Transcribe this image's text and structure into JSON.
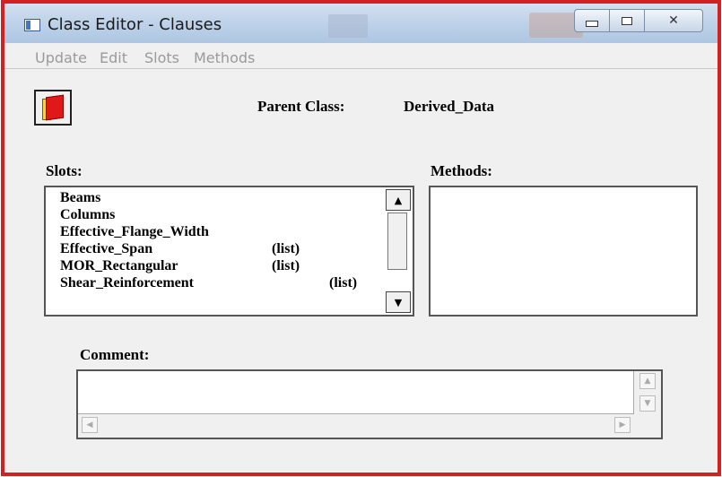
{
  "window": {
    "title": "Class Editor - Clauses",
    "accent_color": "#d42020",
    "controls": {
      "minimize_icon": "minimize-icon",
      "maximize_icon": "maximize-icon",
      "close_glyph": "✕"
    }
  },
  "menu": {
    "items": [
      {
        "label": "Update"
      },
      {
        "label": "Edit"
      },
      {
        "label": "Slots"
      },
      {
        "label": "Methods"
      }
    ]
  },
  "toolbar": {
    "icon": "book-icon"
  },
  "parent_class": {
    "label": "Parent Class:",
    "value": "Derived_Data"
  },
  "slots": {
    "label": "Slots:",
    "items": [
      {
        "name": "Beams",
        "type": ""
      },
      {
        "name": "Columns",
        "type": ""
      },
      {
        "name": "Effective_Flange_Width",
        "type": ""
      },
      {
        "name": "Effective_Span",
        "type": "(list)"
      },
      {
        "name": "MOR_Rectangular",
        "type": "(list)"
      },
      {
        "name": "Shear_Reinforcement",
        "type": "(list)"
      }
    ],
    "scroll_up_glyph": "▲",
    "scroll_down_glyph": "▼"
  },
  "methods": {
    "label": "Methods:",
    "items": []
  },
  "comment": {
    "label": "Comment:",
    "value": "",
    "scroll_up_glyph": "▲",
    "scroll_down_glyph": "▼",
    "scroll_left_glyph": "◀",
    "scroll_right_glyph": "▶"
  }
}
